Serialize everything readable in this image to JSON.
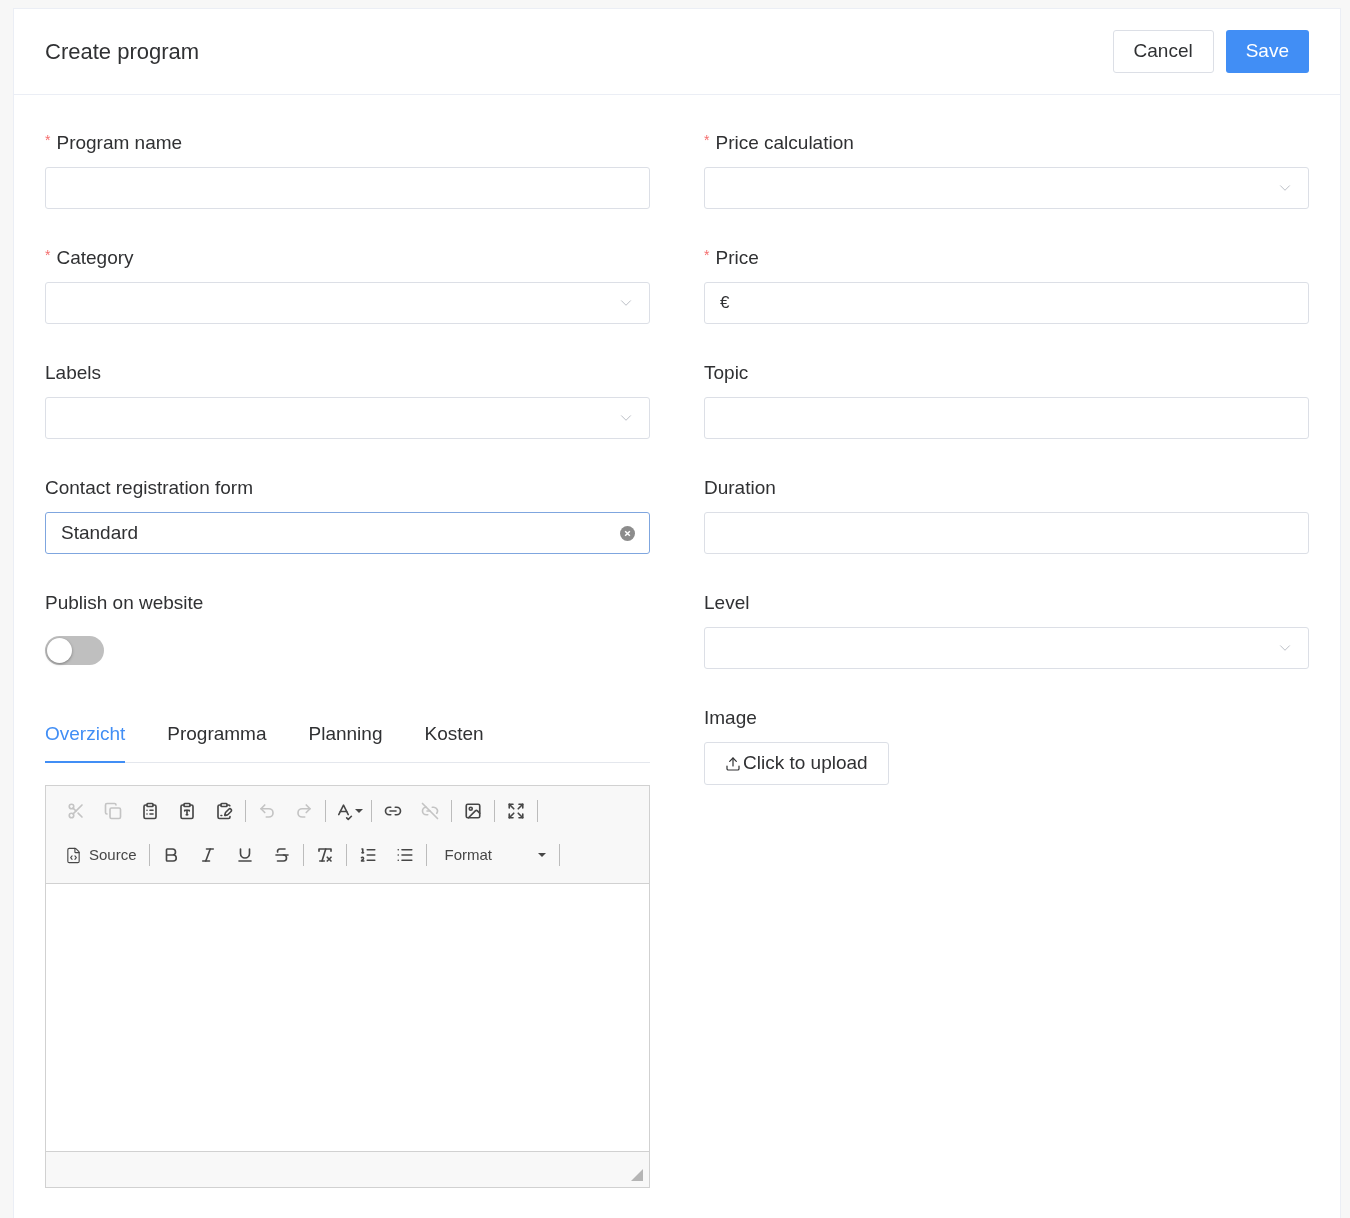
{
  "header": {
    "title": "Create program",
    "buttons": [
      {
        "label": "Cancel",
        "kind": "secondary"
      },
      {
        "label": "Save",
        "kind": "primary"
      }
    ]
  },
  "required_mark": "*",
  "left_fields": [
    {
      "label": "Program name",
      "required": true,
      "kind": "input"
    },
    {
      "label": "Category",
      "required": true,
      "kind": "select"
    },
    {
      "label": "Labels",
      "required": false,
      "kind": "select"
    },
    {
      "label": "Contact registration form",
      "required": false,
      "kind": "clearable",
      "value": "Standard"
    },
    {
      "label": "Publish on website",
      "required": false,
      "kind": "toggle",
      "on": false
    }
  ],
  "tabs": [
    {
      "label": "Overzicht",
      "selected": true
    },
    {
      "label": "Programma",
      "selected": false
    },
    {
      "label": "Planning",
      "selected": false
    },
    {
      "label": "Kosten",
      "selected": false
    }
  ],
  "editor": {
    "rows": [
      {
        "groups": [
          {
            "buttons": [
              {
                "kind": "cut",
                "disabled": true
              },
              {
                "kind": "copy",
                "disabled": true
              },
              {
                "kind": "paste",
                "disabled": false
              },
              {
                "kind": "paste_text",
                "disabled": false
              },
              {
                "kind": "paste_word",
                "disabled": false
              }
            ]
          },
          {
            "buttons": [
              {
                "kind": "undo",
                "disabled": true
              },
              {
                "kind": "redo",
                "disabled": true
              }
            ]
          },
          {
            "buttons": [
              {
                "kind": "spellcheck",
                "disabled": false
              }
            ]
          },
          {
            "buttons": [
              {
                "kind": "link",
                "disabled": false
              },
              {
                "kind": "unlink",
                "disabled": true
              }
            ]
          },
          {
            "buttons": [
              {
                "kind": "image",
                "disabled": false
              }
            ]
          },
          {
            "buttons": [
              {
                "kind": "maximize",
                "disabled": false
              }
            ]
          }
        ]
      },
      {
        "groups": [
          {
            "buttons": [
              {
                "kind": "source",
                "label": "Source",
                "disabled": false
              }
            ]
          },
          {
            "buttons": [
              {
                "kind": "bold",
                "disabled": false
              },
              {
                "kind": "italic",
                "disabled": false
              },
              {
                "kind": "underline",
                "disabled": false
              },
              {
                "kind": "strike",
                "disabled": false
              }
            ]
          },
          {
            "buttons": [
              {
                "kind": "remove_format",
                "disabled": false
              }
            ]
          },
          {
            "buttons": [
              {
                "kind": "numbered_list",
                "disabled": false
              },
              {
                "kind": "bulleted_list",
                "disabled": false
              }
            ]
          },
          {
            "buttons": [
              {
                "kind": "format",
                "label": "Format",
                "disabled": false
              }
            ]
          }
        ]
      }
    ]
  },
  "right_fields": [
    {
      "label": "Price calculation",
      "required": true,
      "kind": "select"
    },
    {
      "label": "Price",
      "required": true,
      "kind": "input",
      "prefix": "€"
    },
    {
      "label": "Topic",
      "required": false,
      "kind": "input"
    },
    {
      "label": "Duration",
      "required": false,
      "kind": "input"
    },
    {
      "label": "Level",
      "required": false,
      "kind": "select"
    },
    {
      "label": "Image",
      "required": false,
      "kind": "upload",
      "button": "Click to upload"
    }
  ]
}
